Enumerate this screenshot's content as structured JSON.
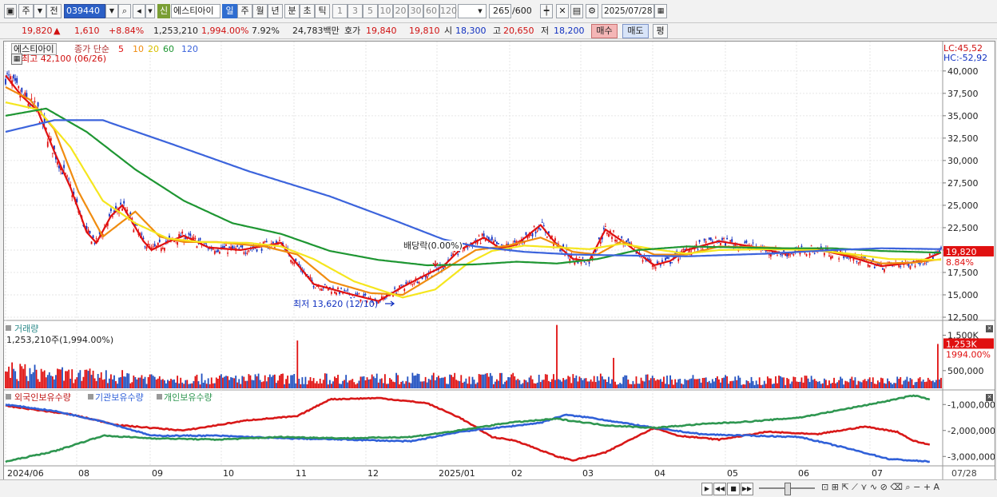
{
  "toolbar": {
    "mode1": "주",
    "mode2": "전",
    "code": "039440",
    "badge": "신",
    "stock_name": "에스티아이",
    "periods": [
      "일",
      "주",
      "월",
      "년",
      "분",
      "초",
      "틱"
    ],
    "intervals": [
      "1",
      "3",
      "5",
      "10",
      "20",
      "30",
      "60",
      "120"
    ],
    "count": "265",
    "max_count": "/600",
    "date": "2025/07/28"
  },
  "info": {
    "price": "19,820",
    "change_arrow": "▲",
    "change": "1,610",
    "change_pct": "+8.84%",
    "volume": "1,253,210",
    "volume_ratio": "1,994.00%",
    "turnover_pct": "7.92%",
    "trade_amount": "24,783백만",
    "quote_label": "호가",
    "ask": "19,840",
    "bid": "19,810",
    "open_label": "시",
    "open": "18,300",
    "high_label": "고",
    "high": "20,650",
    "low_label": "저",
    "low": "18,200",
    "buy_label": "매수",
    "sell_label": "매도",
    "flat_label": "평"
  },
  "price_panel": {
    "name": "에스티아이",
    "ma_label": "종가 단순",
    "ma_periods": [
      "5",
      "10",
      "20",
      "60",
      "120"
    ],
    "colors": {
      "up": "#e01010",
      "down": "#1030c0",
      "ma5": "#e01010",
      "ma10": "#f08c10",
      "ma20": "#f5e61e",
      "ma60": "#1e9632",
      "ma120": "#3c64dc"
    },
    "high_note": "최고 42,100 (06/26)",
    "low_note": "최저 13,620 (12/10)",
    "dividend_note": "배당락(0.00%)",
    "lc": "LC:45,52",
    "hc": "HC:-52,92",
    "price_tag": "19,820",
    "pct_tag": "8.84%",
    "y_ticks": [
      "40,000",
      "37,500",
      "35,000",
      "32,500",
      "30,000",
      "27,500",
      "25,000",
      "22,500",
      "20,000",
      "17,500",
      "15,000",
      "12,500"
    ]
  },
  "volume_panel": {
    "title": "거래량",
    "current": "1,253,210주(1,994.00%)",
    "y_ticks": [
      "1,500K",
      "500,000"
    ],
    "tag": "1,253K",
    "tag_pct": "1994.00%"
  },
  "flow_panel": {
    "legend": [
      "외국인보유수량",
      "기관보유수량",
      "개인보유수량"
    ],
    "colors": [
      "#d81818",
      "#3060d8",
      "#2e9650"
    ],
    "y_ticks": [
      "-1,000,000",
      "-2,000,000",
      "-3,000,000"
    ]
  },
  "x_axis": {
    "labels": [
      "2024/06",
      "08",
      "09",
      "10",
      "11",
      "12",
      "2025/01",
      "02",
      "03",
      "04",
      "05",
      "06",
      "07"
    ],
    "end_label": "07/28"
  },
  "chart_data": [
    {
      "type": "candlestick",
      "title": "에스티아이",
      "ylim": [
        12500,
        41500
      ],
      "annotations": {
        "high": 42100,
        "high_date": "06/26",
        "low": 13620,
        "low_date": "12/10"
      },
      "series": [
        {
          "name": "5",
          "anchors": [
            [
              0,
              39500
            ],
            [
              10,
              37200
            ],
            [
              20,
              35500
            ],
            [
              30,
              31000
            ],
            [
              40,
              27000
            ],
            [
              50,
              22000
            ],
            [
              56,
              20800
            ],
            [
              65,
              23800
            ],
            [
              72,
              25000
            ],
            [
              85,
              21000
            ],
            [
              90,
              20000
            ],
            [
              100,
              20900
            ],
            [
              110,
              21600
            ],
            [
              125,
              20300
            ],
            [
              145,
              20000
            ],
            [
              170,
              20800
            ],
            [
              175,
              19500
            ],
            [
              190,
              16200
            ],
            [
              210,
              15200
            ],
            [
              230,
              14300
            ],
            [
              245,
              15900
            ],
            [
              260,
              17300
            ],
            [
              270,
              18200
            ],
            [
              280,
              20000
            ],
            [
              295,
              21400
            ],
            [
              305,
              20200
            ],
            [
              315,
              20600
            ],
            [
              330,
              22800
            ],
            [
              340,
              20600
            ],
            [
              350,
              19000
            ],
            [
              360,
              18800
            ],
            [
              370,
              22300
            ],
            [
              385,
              20400
            ],
            [
              400,
              18300
            ],
            [
              410,
              18800
            ],
            [
              420,
              20000
            ],
            [
              440,
              21000
            ],
            [
              460,
              20400
            ],
            [
              480,
              19600
            ],
            [
              500,
              20100
            ],
            [
              520,
              19300
            ],
            [
              540,
              18200
            ],
            [
              555,
              18500
            ],
            [
              565,
              18800
            ],
            [
              578,
              19800
            ]
          ]
        },
        {
          "name": "10",
          "anchors": [
            [
              0,
              38200
            ],
            [
              15,
              36800
            ],
            [
              30,
              33500
            ],
            [
              45,
              26500
            ],
            [
              60,
              21500
            ],
            [
              80,
              24300
            ],
            [
              95,
              21500
            ],
            [
              110,
              20900
            ],
            [
              130,
              20900
            ],
            [
              160,
              20400
            ],
            [
              180,
              19500
            ],
            [
              200,
              16500
            ],
            [
              225,
              15200
            ],
            [
              245,
              15000
            ],
            [
              265,
              17200
            ],
            [
              290,
              20000
            ],
            [
              310,
              20500
            ],
            [
              330,
              21400
            ],
            [
              350,
              19800
            ],
            [
              365,
              19500
            ],
            [
              380,
              21000
            ],
            [
              400,
              19500
            ],
            [
              420,
              19500
            ],
            [
              440,
              20400
            ],
            [
              470,
              20300
            ],
            [
              500,
              20000
            ],
            [
              520,
              19500
            ],
            [
              540,
              18500
            ],
            [
              560,
              18600
            ],
            [
              578,
              19000
            ]
          ]
        },
        {
          "name": "20",
          "anchors": [
            [
              0,
              36500
            ],
            [
              20,
              35700
            ],
            [
              40,
              31500
            ],
            [
              60,
              25500
            ],
            [
              80,
              23000
            ],
            [
              100,
              21300
            ],
            [
              120,
              20900
            ],
            [
              150,
              20800
            ],
            [
              170,
              20400
            ],
            [
              190,
              19000
            ],
            [
              215,
              16500
            ],
            [
              245,
              14700
            ],
            [
              265,
              15600
            ],
            [
              285,
              18500
            ],
            [
              300,
              19900
            ],
            [
              320,
              20500
            ],
            [
              340,
              20300
            ],
            [
              360,
              20100
            ],
            [
              380,
              20700
            ],
            [
              400,
              20100
            ],
            [
              420,
              19600
            ],
            [
              440,
              20000
            ],
            [
              470,
              20100
            ],
            [
              500,
              20000
            ],
            [
              520,
              19600
            ],
            [
              545,
              19000
            ],
            [
              578,
              18900
            ]
          ]
        },
        {
          "name": "60",
          "anchors": [
            [
              0,
              35000
            ],
            [
              25,
              35800
            ],
            [
              50,
              33200
            ],
            [
              80,
              29000
            ],
            [
              110,
              25500
            ],
            [
              140,
              23000
            ],
            [
              170,
              21800
            ],
            [
              200,
              19900
            ],
            [
              230,
              18900
            ],
            [
              260,
              18300
            ],
            [
              290,
              18400
            ],
            [
              315,
              18700
            ],
            [
              340,
              18500
            ],
            [
              365,
              19000
            ],
            [
              390,
              20000
            ],
            [
              420,
              20400
            ],
            [
              450,
              20300
            ],
            [
              480,
              20200
            ],
            [
              510,
              20200
            ],
            [
              540,
              19900
            ],
            [
              578,
              19700
            ]
          ]
        },
        {
          "name": "120",
          "anchors": [
            [
              0,
              33200
            ],
            [
              30,
              34500
            ],
            [
              60,
              34500
            ],
            [
              100,
              32000
            ],
            [
              150,
              28800
            ],
            [
              200,
              26000
            ],
            [
              240,
              23300
            ],
            [
              270,
              21200
            ],
            [
              290,
              20400
            ],
            [
              320,
              19800
            ],
            [
              350,
              19500
            ],
            [
              380,
              19400
            ],
            [
              420,
              19300
            ],
            [
              470,
              19600
            ],
            [
              510,
              20000
            ],
            [
              540,
              20200
            ],
            [
              578,
              20100
            ]
          ]
        }
      ]
    },
    {
      "type": "bar",
      "title": "거래량",
      "ylim": [
        0,
        1850000
      ],
      "values": {
        "typical": 300000,
        "spikes": [
          [
            180,
            1350000
          ],
          [
            340,
            1790000
          ],
          [
            375,
            860000
          ],
          [
            575,
            1253210
          ]
        ]
      }
    },
    {
      "type": "line",
      "ylim": [
        -3300000,
        -500000
      ],
      "series": [
        {
          "name": "외국인보유수량",
          "anchors": [
            [
              0,
              -1050000
            ],
            [
              40,
              -1380000
            ],
            [
              70,
              -1800000
            ],
            [
              110,
              -2000000
            ],
            [
              150,
              -1600000
            ],
            [
              180,
              -1450000
            ],
            [
              200,
              -800000
            ],
            [
              230,
              -750000
            ],
            [
              260,
              -950000
            ],
            [
              280,
              -1500000
            ],
            [
              300,
              -2250000
            ],
            [
              315,
              -2400000
            ],
            [
              340,
              -3000000
            ],
            [
              350,
              -3150000
            ],
            [
              370,
              -2850000
            ],
            [
              390,
              -2200000
            ],
            [
              400,
              -1900000
            ],
            [
              415,
              -2200000
            ],
            [
              440,
              -2350000
            ],
            [
              470,
              -2050000
            ],
            [
              500,
              -2150000
            ],
            [
              530,
              -1850000
            ],
            [
              550,
              -2050000
            ],
            [
              560,
              -2400000
            ],
            [
              570,
              -2550000
            ]
          ]
        },
        {
          "name": "기관보유수량",
          "anchors": [
            [
              0,
              -1000000
            ],
            [
              30,
              -1250000
            ],
            [
              60,
              -1650000
            ],
            [
              90,
              -2200000
            ],
            [
              130,
              -2200000
            ],
            [
              170,
              -2300000
            ],
            [
              210,
              -2350000
            ],
            [
              250,
              -2420000
            ],
            [
              280,
              -2050000
            ],
            [
              310,
              -1850000
            ],
            [
              330,
              -1700000
            ],
            [
              345,
              -1400000
            ],
            [
              360,
              -1500000
            ],
            [
              380,
              -1700000
            ],
            [
              400,
              -1900000
            ],
            [
              430,
              -2150000
            ],
            [
              460,
              -2200000
            ],
            [
              490,
              -2250000
            ],
            [
              520,
              -2700000
            ],
            [
              545,
              -3100000
            ],
            [
              570,
              -3200000
            ]
          ]
        },
        {
          "name": "개인보유수량",
          "anchors": [
            [
              0,
              -3200000
            ],
            [
              30,
              -2800000
            ],
            [
              60,
              -2200000
            ],
            [
              90,
              -2300000
            ],
            [
              130,
              -2350000
            ],
            [
              170,
              -2250000
            ],
            [
              210,
              -2300000
            ],
            [
              250,
              -2250000
            ],
            [
              280,
              -2000000
            ],
            [
              310,
              -1700000
            ],
            [
              340,
              -1550000
            ],
            [
              370,
              -1800000
            ],
            [
              400,
              -1900000
            ],
            [
              430,
              -1750000
            ],
            [
              460,
              -1650000
            ],
            [
              490,
              -1500000
            ],
            [
              520,
              -1150000
            ],
            [
              545,
              -850000
            ],
            [
              560,
              -650000
            ],
            [
              570,
              -800000
            ]
          ]
        }
      ]
    }
  ]
}
